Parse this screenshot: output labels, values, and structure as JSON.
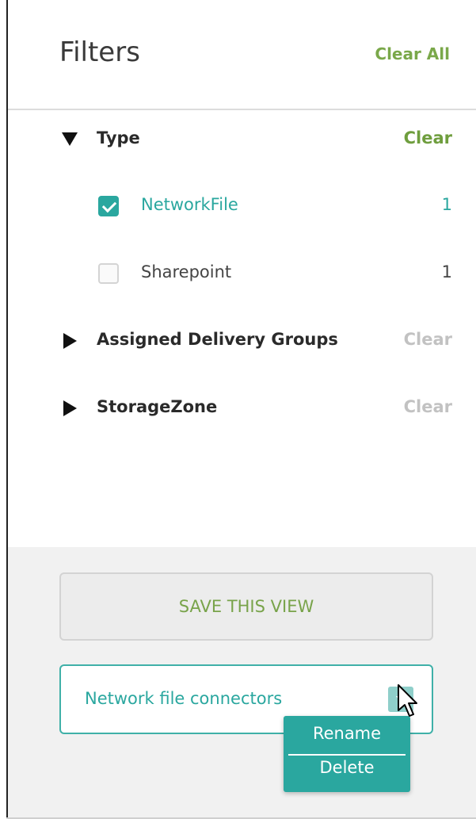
{
  "header": {
    "title": "Filters",
    "clear_all_label": "Clear All"
  },
  "sections": [
    {
      "label": "Type",
      "expanded": true,
      "clear_label": "Clear",
      "clear_active": true,
      "options": [
        {
          "name": "NetworkFile",
          "count": "1",
          "checked": true
        },
        {
          "name": "Sharepoint",
          "count": "1",
          "checked": false
        }
      ]
    },
    {
      "label": "Assigned Delivery Groups",
      "expanded": false,
      "clear_label": "Clear",
      "clear_active": false
    },
    {
      "label": "StorageZone",
      "expanded": false,
      "clear_label": "Clear",
      "clear_active": false
    }
  ],
  "footer": {
    "save_button_label": "SAVE THIS VIEW",
    "saved_view": {
      "value": "Network file connectors"
    },
    "menu_items": [
      "Rename",
      "Delete"
    ]
  },
  "colors": {
    "accent": "#2aa79f",
    "green": "#7aa84a",
    "inactive": "#c2c2c2"
  },
  "icons": {
    "expand": "triangle-down-icon",
    "collapse": "triangle-right-icon",
    "dropdown": "chevron-down-icon",
    "cursor": "mouse-pointer-icon"
  }
}
